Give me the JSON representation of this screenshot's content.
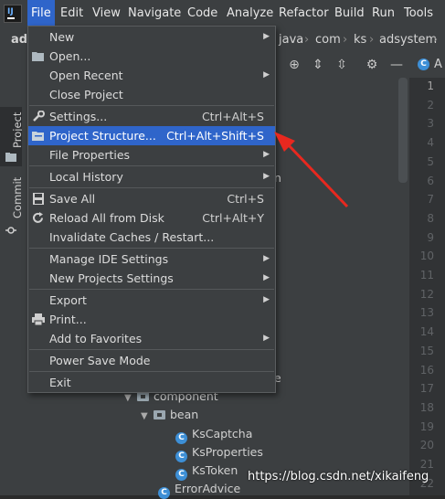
{
  "menubar": {
    "items": [
      "File",
      "Edit",
      "View",
      "Navigate",
      "Code",
      "Analyze",
      "Refactor",
      "Build",
      "Run",
      "Tools"
    ],
    "active": "File"
  },
  "navbar": {
    "project_stub": "ad",
    "path": [
      "java",
      "com",
      "ks",
      "adsystem"
    ]
  },
  "sidebar": {
    "project_label": "Project",
    "commit_label": "Commit"
  },
  "editor": {
    "tab_label": "A",
    "line_numbers": [
      "1",
      "2",
      "3",
      "4",
      "5",
      "6",
      "7",
      "8",
      "9",
      "10",
      "11",
      "12",
      "13",
      "14",
      "15",
      "16",
      "17",
      "18",
      "19",
      "20",
      "21",
      "22"
    ]
  },
  "tree": {
    "partial_right_1": "n",
    "partial_right_2": "e",
    "component": "component",
    "bean": "bean",
    "classes": [
      "KsCaptcha",
      "KsProperties",
      "KsToken"
    ],
    "error_advice": "ErrorAdvice"
  },
  "file_menu": {
    "new": "New",
    "open": "Open...",
    "open_recent": "Open Recent",
    "close_project": "Close Project",
    "settings": "Settings...",
    "settings_shortcut": "Ctrl+Alt+S",
    "project_structure": "Project Structure...",
    "project_structure_shortcut": "Ctrl+Alt+Shift+S",
    "file_properties": "File Properties",
    "local_history": "Local History",
    "save_all": "Save All",
    "save_all_shortcut": "Ctrl+S",
    "reload": "Reload All from Disk",
    "reload_shortcut": "Ctrl+Alt+Y",
    "invalidate": "Invalidate Caches / Restart...",
    "manage_ide": "Manage IDE Settings",
    "new_projects_settings": "New Projects Settings",
    "export": "Export",
    "print": "Print...",
    "add_to_favorites": "Add to Favorites",
    "power_save": "Power Save Mode",
    "exit": "Exit"
  },
  "watermark": "https://blog.csdn.net/xikaifeng",
  "colors": {
    "highlight": "#2f65ca",
    "annotation_arrow": "#e8281f",
    "class_icon": "#3d8fd6"
  }
}
